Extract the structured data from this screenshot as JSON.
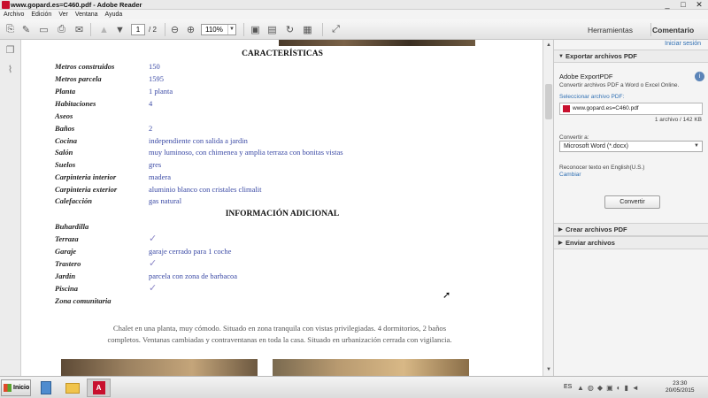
{
  "window": {
    "title": "www.gopard.es=C460.pdf - Adobe Reader",
    "controls": [
      "_",
      "□",
      "✕"
    ]
  },
  "menu": [
    "Archivo",
    "Edición",
    "Ver",
    "Ventana",
    "Ayuda"
  ],
  "toolbar": {
    "page_current": "1",
    "page_total": "/ 2",
    "zoom": "110%",
    "tab_tools": "Herramientas",
    "tab_comment": "Comentario"
  },
  "document": {
    "section1_title": "CARACTERÍSTICAS",
    "section2_title": "INFORMACIÓN ADICIONAL",
    "characteristics": [
      {
        "label": "Metros construidos",
        "value": "150"
      },
      {
        "label": "Metros parcela",
        "value": "1595"
      },
      {
        "label": "Planta",
        "value": "1 planta"
      },
      {
        "label": "Habitaciones",
        "value": "4"
      },
      {
        "label": "Aseos",
        "value": ""
      },
      {
        "label": "Baños",
        "value": "2"
      },
      {
        "label": "Cocina",
        "value": "independiente con salida a jardin"
      },
      {
        "label": "Salón",
        "value": "muy luminoso, con chimenea y amplia terraza con bonitas vistas"
      },
      {
        "label": "Suelos",
        "value": "gres"
      },
      {
        "label": "Carpinteria interior",
        "value": "madera"
      },
      {
        "label": "Carpinteria exterior",
        "value": "aluminio blanco con cristales climalit"
      },
      {
        "label": "Calefacción",
        "value": "gas natural"
      }
    ],
    "additional": [
      {
        "label": "Buhardilla",
        "value": ""
      },
      {
        "label": "Terraza",
        "value": "✓"
      },
      {
        "label": "Garaje",
        "value": "garaje cerrado para 1 coche"
      },
      {
        "label": "Trastero",
        "value": "✓"
      },
      {
        "label": "Jardín",
        "value": "parcela con zona de barbacoa"
      },
      {
        "label": "Piscina",
        "value": "✓"
      },
      {
        "label": "Zona comunitaria",
        "value": ""
      }
    ],
    "description_line1": "Chalet en una planta, muy cómodo. Situado en zona tranquila con vistas privilegiadas. 4 dormitorios, 2 baños",
    "description_line2": "completos. Ventanas cambiadas y contraventanas en toda la casa. Situado en urbanización cerrada con vigilancia."
  },
  "right_pane": {
    "sign_in": "Iniciar sesión",
    "export_header": "Exportar archivos PDF",
    "service_title": "Adobe ExportPDF",
    "service_sub": "Convertir archivos PDF a Word o Excel Online.",
    "select_label": "Seleccionar archivo PDF:",
    "file_name": "www.gopard.es=C460.pdf",
    "file_count": "1 archivo / 142 KB",
    "convert_to_label": "Convertir a:",
    "convert_to_value": "Microsoft Word (*.docx)",
    "ocr_text": "Reconocer texto en English(U.S.)",
    "change_link": "Cambiar",
    "convert_button": "Convertir",
    "create_header": "Crear archivos PDF",
    "send_header": "Enviar archivos"
  },
  "taskbar": {
    "start": "Inicio",
    "lang": "ES",
    "time": "23:30",
    "date": "20/05/2015"
  }
}
